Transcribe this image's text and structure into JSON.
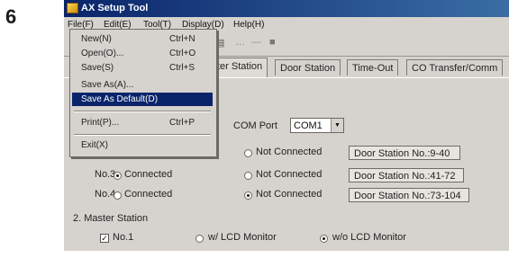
{
  "step_number": "6",
  "window": {
    "title": "AX Setup Tool"
  },
  "menubar": [
    "File(F)",
    "Edit(E)",
    "Tool(T)",
    "Display(D)",
    "Help(H)"
  ],
  "file_menu": {
    "items": [
      {
        "label": "New(N)",
        "shortcut": "Ctrl+N"
      },
      {
        "label": "Open(O)...",
        "shortcut": "Ctrl+O"
      },
      {
        "label": "Save(S)",
        "shortcut": "Ctrl+S"
      },
      {
        "label": "Save As(A)...",
        "shortcut": ""
      },
      {
        "label": "Save As Default(D)",
        "shortcut": ""
      },
      {
        "label": "Print(P)...",
        "shortcut": "Ctrl+P"
      },
      {
        "label": "Exit(X)",
        "shortcut": ""
      }
    ],
    "highlighted": "Save As Default(D)"
  },
  "tabs": [
    "ter Station",
    "Door Station",
    "Time-Out",
    "CO Transfer/Comm"
  ],
  "com_port": {
    "label": "COM Port",
    "value": "COM1"
  },
  "door_rows": [
    {
      "no": "",
      "connected": "",
      "not_connected": "Not Connected",
      "range": "Door Station No.:9-40",
      "selected": "none"
    },
    {
      "no": "No.3",
      "connected": "Connected",
      "not_connected": "Not Connected",
      "range": "Door Station No.:41-72",
      "selected": "connected"
    },
    {
      "no": "No.4",
      "connected": "Connected",
      "not_connected": "Not Connected",
      "range": "Door Station No.:73-104",
      "selected": "not_connected"
    }
  ],
  "master_station": {
    "heading": "2. Master Station",
    "no1": "No.1",
    "lcd_with": "w/ LCD Monitor",
    "lcd_without": "w/o LCD Monitor"
  }
}
